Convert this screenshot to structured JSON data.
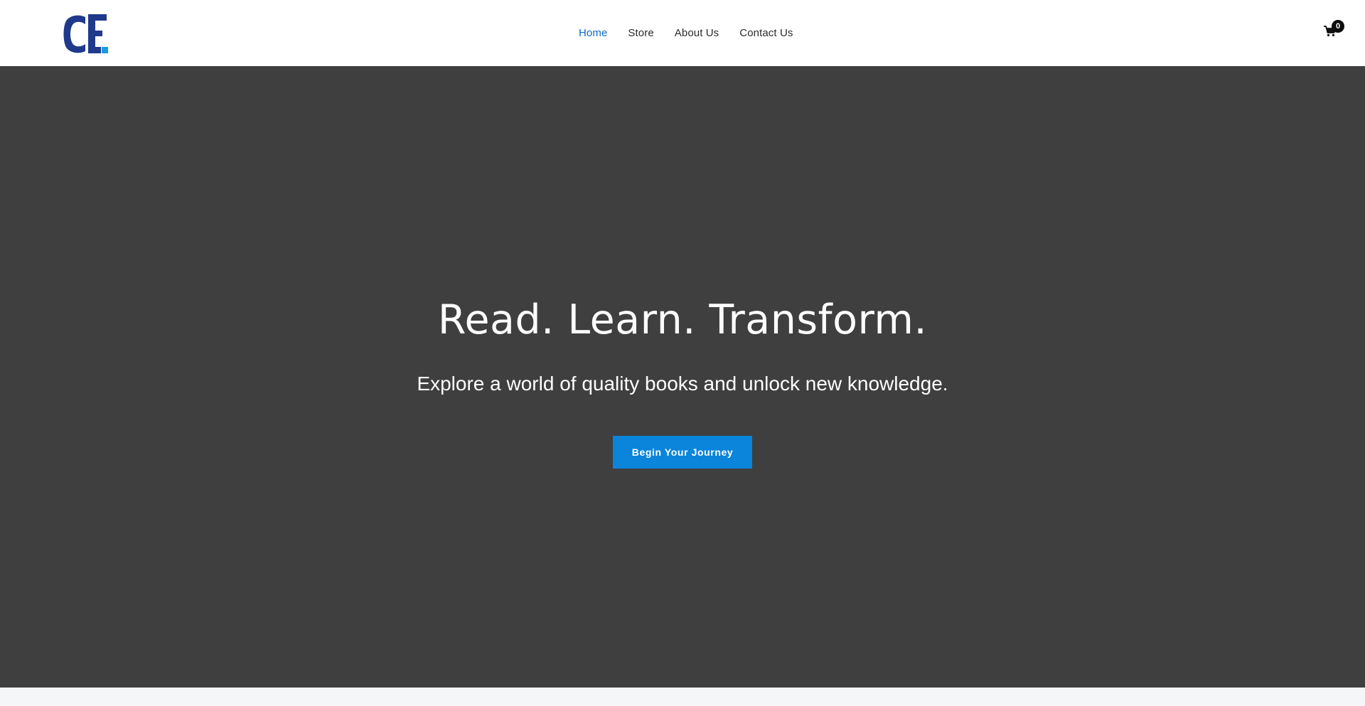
{
  "header": {
    "logo_text": "CE",
    "nav": [
      {
        "label": "Home",
        "active": true
      },
      {
        "label": "Store",
        "active": false
      },
      {
        "label": "About Us",
        "active": false
      },
      {
        "label": "Contact Us",
        "active": false
      }
    ],
    "cart_count": "0"
  },
  "hero": {
    "title": "Read. Learn. Transform.",
    "subtitle": "Explore a world of quality books and unlock new knowledge.",
    "button_label": "Begin Your Journey"
  },
  "colors": {
    "brand_blue": "#1f3a8a",
    "accent_blue": "#0a85db",
    "active_nav": "#0a6bc9",
    "hero_bg": "#3f3f3f"
  },
  "icons": {
    "cart": "cart-icon"
  }
}
